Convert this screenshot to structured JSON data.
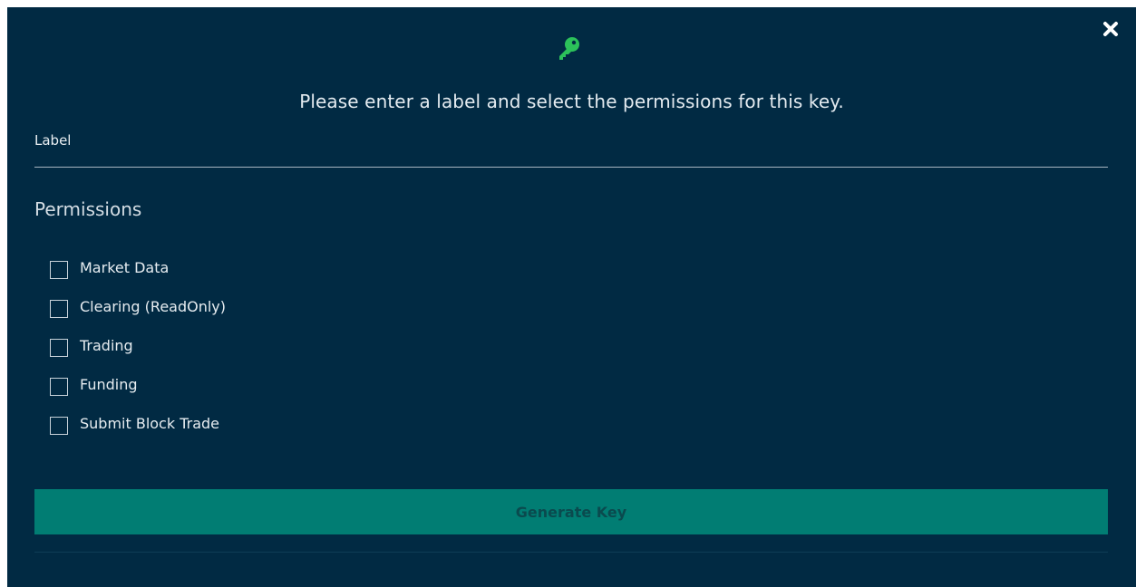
{
  "modal": {
    "close_icon": "close-icon",
    "key_icon": "key-icon",
    "key_icon_color": "#2cc15a",
    "prompt": "Please enter a label and select the permissions for this key.",
    "label_field": {
      "label": "Label",
      "value": ""
    },
    "permissions": {
      "title": "Permissions",
      "items": [
        {
          "label": "Market Data",
          "checked": false
        },
        {
          "label": "Clearing (ReadOnly)",
          "checked": false
        },
        {
          "label": "Trading",
          "checked": false
        },
        {
          "label": "Funding",
          "checked": false
        },
        {
          "label": "Submit Block Trade",
          "checked": false
        }
      ]
    },
    "generate_button_label": "Generate Key",
    "colors": {
      "background": "#012a43",
      "button": "#017d73",
      "button_text": "#0a4a4e"
    }
  }
}
